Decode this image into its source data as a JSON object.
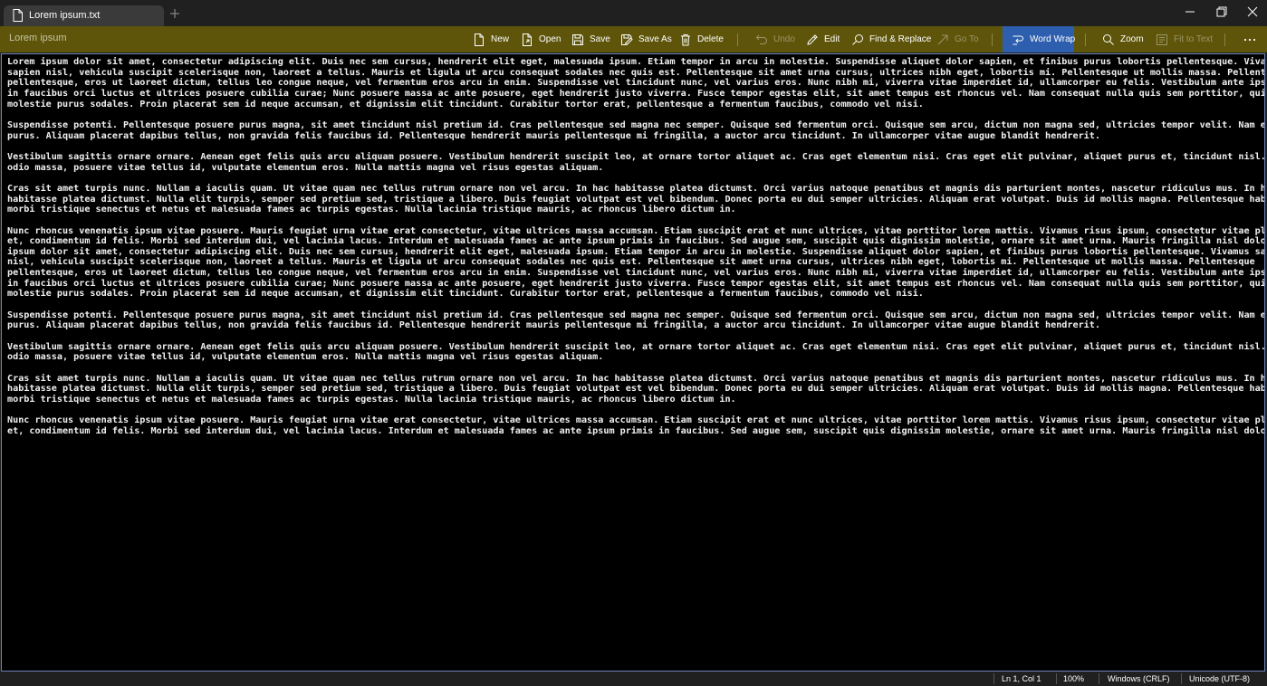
{
  "tab": {
    "title": "Lorem ipsum.txt"
  },
  "toolbar": {
    "document_title": "Lorem ipsum",
    "new_label": "New",
    "open_label": "Open",
    "save_label": "Save",
    "save_as_label": "Save As",
    "delete_label": "Delete",
    "undo_label": "Undo",
    "edit_label": "Edit",
    "find_replace_label": "Find & Replace",
    "go_to_label": "Go To",
    "word_wrap_label": "Word Wrap",
    "zoom_label": "Zoom",
    "fit_to_text_label": "Fit to Text"
  },
  "editor": {
    "text": "Lorem ipsum dolor sit amet, consectetur adipiscing elit. Duis nec sem cursus, hendrerit elit eget, malesuada ipsum. Etiam tempor in arcu in molestie. Suspendisse aliquet dolor sapien, et finibus purus lobortis pellentesque. Vivamus\nsapien nisl, vehicula suscipit scelerisque non, laoreet a tellus. Mauris et ligula ut arcu consequat sodales nec quis est. Pellentesque sit amet urna cursus, ultrices nibh eget, lobortis mi. Pellentesque ut mollis massa. Pellentesque\npellentesque, eros ut laoreet dictum, tellus leo congue neque, vel fermentum eros arcu in enim. Suspendisse vel tincidunt nunc, vel varius eros. Nunc nibh mi, viverra vitae imperdiet id, ullamcorper eu felis. Vestibulum ante ipsum primis\nin faucibus orci luctus et ultrices posuere cubilia curae; Nunc posuere massa ac ante posuere, eget hendrerit justo viverra. Fusce tempor egestas elit, sit amet tempus est rhoncus vel. Nam consequat nulla quis sem porttitor, quis\nmolestie purus sodales. Proin placerat sem id neque accumsan, et dignissim elit tincidunt. Curabitur tortor erat, pellentesque a fermentum faucibus, commodo vel nisi.\n\nSuspendisse potenti. Pellentesque posuere purus magna, sit amet tincidunt nisl pretium id. Cras pellentesque sed magna nec semper. Quisque sed fermentum orci. Quisque sem arcu, dictum non magna sed, ultricies tempor velit. Nam eu pretium\npurus. Aliquam placerat dapibus tellus, non gravida felis faucibus id. Pellentesque hendrerit mauris pellentesque mi fringilla, a auctor arcu tincidunt. In ullamcorper vitae augue blandit hendrerit.\n\nVestibulum sagittis ornare ornare. Aenean eget felis quis arcu aliquam posuere. Vestibulum hendrerit suscipit leo, at ornare tortor aliquet ac. Cras eget elementum nisi. Cras eget elit pulvinar, aliquet purus et, tincidunt nisl. Aliquam\nodio massa, posuere vitae tellus id, vulputate elementum eros. Nulla mattis magna vel risus egestas aliquam.\n\nCras sit amet turpis nunc. Nullam a iaculis quam. Ut vitae quam nec tellus rutrum ornare non vel arcu. In hac habitasse platea dictumst. Orci varius natoque penatibus et magnis dis parturient montes, nascetur ridiculus mus. In hac\nhabitasse platea dictumst. Nulla elit turpis, semper sed pretium sed, tristique a libero. Duis feugiat volutpat est vel bibendum. Donec porta eu dui semper ultricies. Aliquam erat volutpat. Duis id mollis magna. Pellentesque habitant\nmorbi tristique senectus et netus et malesuada fames ac turpis egestas. Nulla lacinia tristique mauris, ac rhoncus libero dictum in.\n\nNunc rhoncus venenatis ipsum vitae posuere. Mauris feugiat urna vitae erat consectetur, vitae ultrices massa accumsan. Etiam suscipit erat et nunc ultrices, vitae porttitor lorem mattis. Vivamus risus ipsum, consectetur vitae placerat\net, condimentum id felis. Morbi sed interdum dui, vel lacinia lacus. Interdum et malesuada fames ac ante ipsum primis in faucibus. Sed augue sem, suscipit quis dignissim molestie, ornare sit amet urna. Mauris fringilla nisl dolor.Lorem\nipsum dolor sit amet, consectetur adipiscing elit. Duis nec sem cursus, hendrerit elit eget, malesuada ipsum. Etiam tempor in arcu in molestie. Suspendisse aliquet dolor sapien, et finibus purus lobortis pellentesque. Vivamus sapien\nnisl, vehicula suscipit scelerisque non, laoreet a tellus. Mauris et ligula ut arcu consequat sodales nec quis est. Pellentesque sit amet urna cursus, ultrices nibh eget, lobortis mi. Pellentesque ut mollis massa. Pellentesque\npellentesque, eros ut laoreet dictum, tellus leo congue neque, vel fermentum eros arcu in enim. Suspendisse vel tincidunt nunc, vel varius eros. Nunc nibh mi, viverra vitae imperdiet id, ullamcorper eu felis. Vestibulum ante ipsum primis\nin faucibus orci luctus et ultrices posuere cubilia curae; Nunc posuere massa ac ante posuere, eget hendrerit justo viverra. Fusce tempor egestas elit, sit amet tempus est rhoncus vel. Nam consequat nulla quis sem porttitor, quis\nmolestie purus sodales. Proin placerat sem id neque accumsan, et dignissim elit tincidunt. Curabitur tortor erat, pellentesque a fermentum faucibus, commodo vel nisi.\n\nSuspendisse potenti. Pellentesque posuere purus magna, sit amet tincidunt nisl pretium id. Cras pellentesque sed magna nec semper. Quisque sed fermentum orci. Quisque sem arcu, dictum non magna sed, ultricies tempor velit. Nam eu pretium\npurus. Aliquam placerat dapibus tellus, non gravida felis faucibus id. Pellentesque hendrerit mauris pellentesque mi fringilla, a auctor arcu tincidunt. In ullamcorper vitae augue blandit hendrerit.\n\nVestibulum sagittis ornare ornare. Aenean eget felis quis arcu aliquam posuere. Vestibulum hendrerit suscipit leo, at ornare tortor aliquet ac. Cras eget elementum nisi. Cras eget elit pulvinar, aliquet purus et, tincidunt nisl. Aliquam\nodio massa, posuere vitae tellus id, vulputate elementum eros. Nulla mattis magna vel risus egestas aliquam.\n\nCras sit amet turpis nunc. Nullam a iaculis quam. Ut vitae quam nec tellus rutrum ornare non vel arcu. In hac habitasse platea dictumst. Orci varius natoque penatibus et magnis dis parturient montes, nascetur ridiculus mus. In hac\nhabitasse platea dictumst. Nulla elit turpis, semper sed pretium sed, tristique a libero. Duis feugiat volutpat est vel bibendum. Donec porta eu dui semper ultricies. Aliquam erat volutpat. Duis id mollis magna. Pellentesque habitant\nmorbi tristique senectus et netus et malesuada fames ac turpis egestas. Nulla lacinia tristique mauris, ac rhoncus libero dictum in.\n\nNunc rhoncus venenatis ipsum vitae posuere. Mauris feugiat urna vitae erat consectetur, vitae ultrices massa accumsan. Etiam suscipit erat et nunc ultrices, vitae porttitor lorem mattis. Vivamus risus ipsum, consectetur vitae placerat\net, condimentum id felis. Morbi sed interdum dui, vel lacinia lacus. Interdum et malesuada fames ac ante ipsum primis in faucibus. Sed augue sem, suscipit quis dignissim molestie, ornare sit amet urna. Mauris fringilla nisl dolor."
  },
  "status": {
    "position": "Ln 1, Col 1",
    "zoom": "100%",
    "line_ending": "Windows (CRLF)",
    "encoding": "Unicode (UTF-8)"
  },
  "colors": {
    "toolbar_bg": "#5e540a",
    "accent": "#2e5fae",
    "editor_bg": "#000000",
    "chrome_bg": "#202020"
  },
  "icons": [
    "file-icon",
    "plus-icon",
    "minimize-icon",
    "restore-icon",
    "close-icon",
    "new-file-icon",
    "open-file-icon",
    "save-icon",
    "save-as-icon",
    "trash-icon",
    "undo-icon",
    "pencil-icon",
    "search-icon",
    "arrow-icon",
    "wrap-icon",
    "zoom-icon",
    "fit-icon",
    "more-icon"
  ]
}
